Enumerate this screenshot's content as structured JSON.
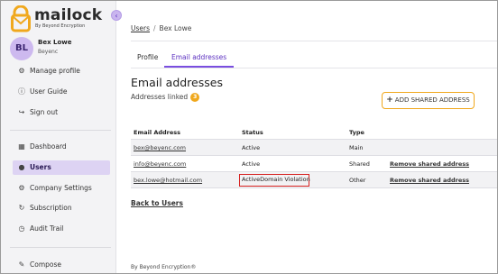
{
  "brand": {
    "name": "mailock",
    "tagline": "By Beyond Encryption",
    "accent": "#f0a81d",
    "primary": "#7a4ee0"
  },
  "sidebar": {
    "collapse_icon": "chevron-left-icon",
    "user": {
      "initials": "BL",
      "name": "Bex Lowe",
      "org": "Beyenc"
    },
    "top_items": [
      {
        "label": "Manage profile",
        "icon": "user-gear-icon"
      },
      {
        "label": "User Guide",
        "icon": "question-circle-icon"
      },
      {
        "label": "Sign out",
        "icon": "sign-out-icon"
      }
    ],
    "items": [
      {
        "label": "Dashboard",
        "icon": "dashboard-icon"
      },
      {
        "label": "Users",
        "icon": "users-icon",
        "active": true
      },
      {
        "label": "Company Settings",
        "icon": "gear-icon"
      },
      {
        "label": "Subscription",
        "icon": "refresh-icon"
      },
      {
        "label": "Audit Trail",
        "icon": "clock-icon"
      }
    ],
    "bottom_items": [
      {
        "label": "Compose",
        "icon": "compose-icon"
      }
    ]
  },
  "breadcrumb": {
    "root": "Users",
    "current": "Bex Lowe"
  },
  "tabs": [
    {
      "label": "Profile"
    },
    {
      "label": "Email addresses",
      "active": true
    }
  ],
  "section": {
    "title": "Email addresses",
    "linked_label": "Addresses linked",
    "linked_count": "3",
    "add_button": "ADD SHARED ADDRESS"
  },
  "table": {
    "headers": [
      "Email Address",
      "Status",
      "Type",
      ""
    ],
    "rows": [
      {
        "email": "bex@beyenc.com",
        "status": "Active",
        "type": "Main",
        "action": ""
      },
      {
        "email": "info@beyenc.com",
        "status": "Active",
        "type": "Shared",
        "action": "Remove shared address"
      },
      {
        "email": "bex.lowe@hotmail.com",
        "status": "ActiveDomain Violation",
        "type": "Other",
        "action": "Remove shared address"
      }
    ]
  },
  "back_link": "Back to Users",
  "footer": "By Beyond Encryption®"
}
